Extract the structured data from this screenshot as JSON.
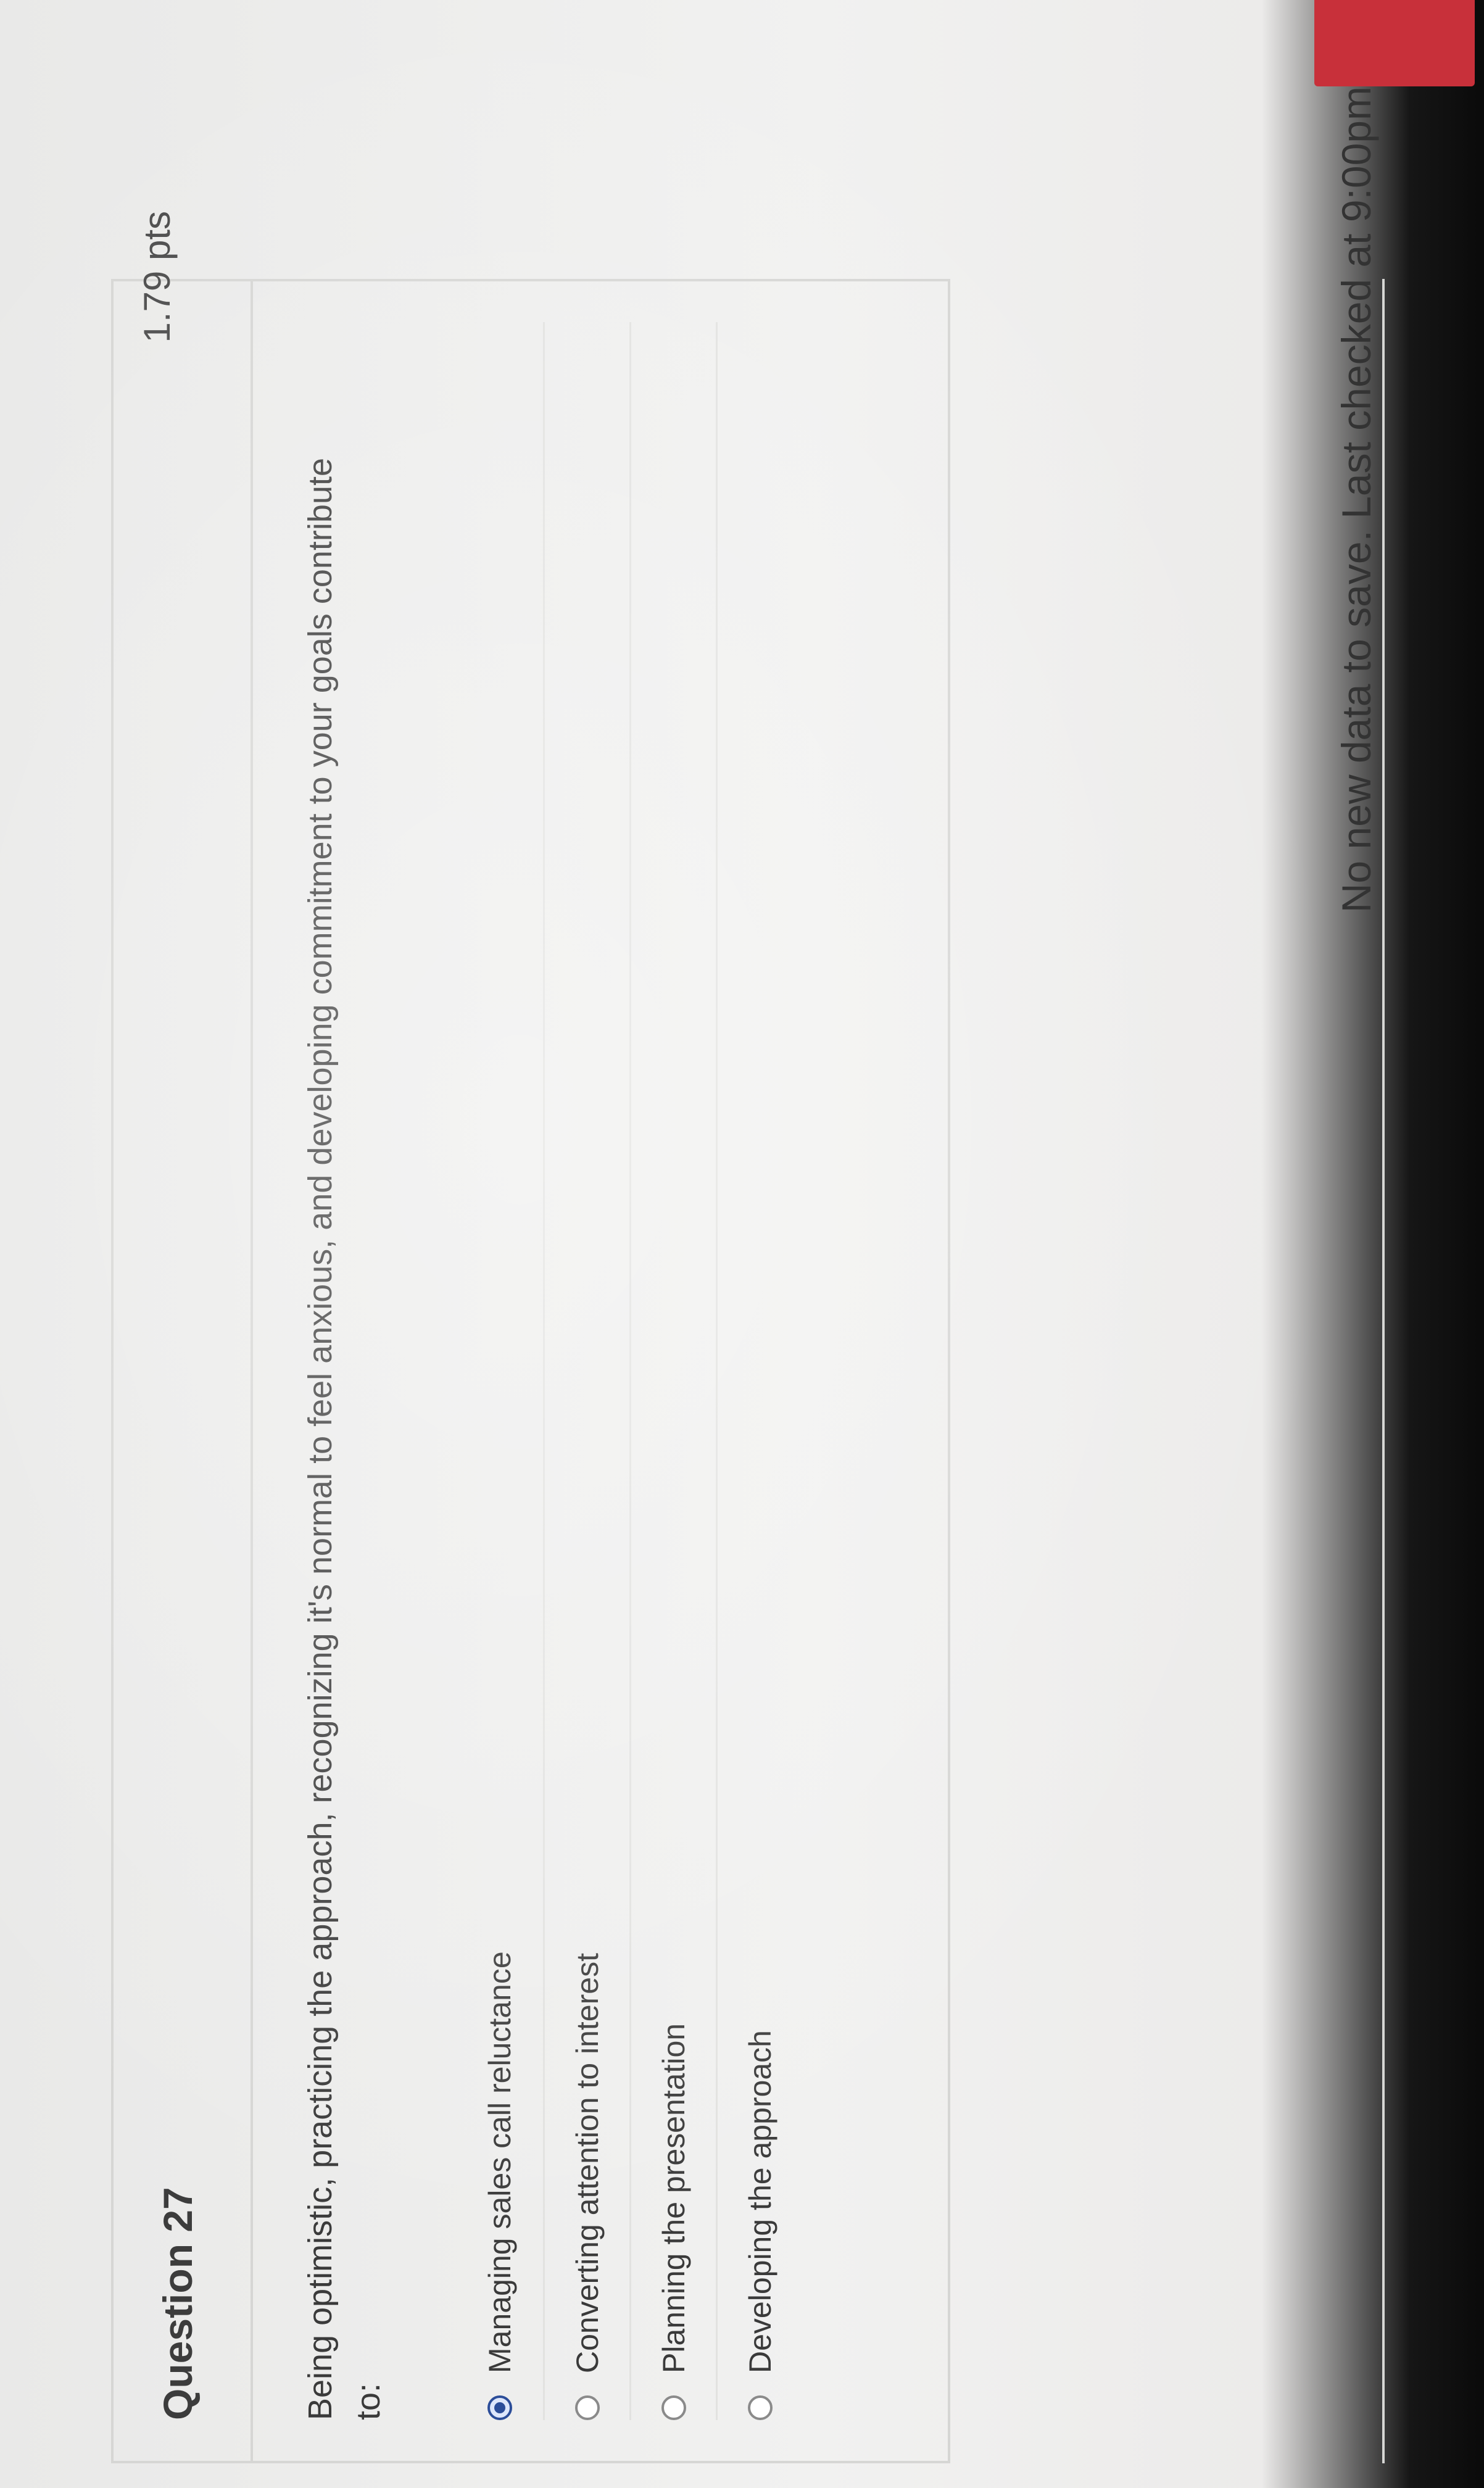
{
  "question": {
    "title": "Question 27",
    "points": "1.79 pts",
    "text": "Being optimistic, practicing the approach, recognizing it's normal to feel anxious, and developing commitment to your goals contribute to:"
  },
  "answers": [
    {
      "label": "Managing sales call reluctance",
      "selected": true
    },
    {
      "label": "Converting attention to interest",
      "selected": false
    },
    {
      "label": "Planning the presentation",
      "selected": false
    },
    {
      "label": "Developing the approach",
      "selected": false
    }
  ],
  "status": {
    "text": "No new data to save. Last checked at 9:00pm"
  },
  "colors": {
    "selected_radio": "#2b4d99",
    "submit_button": "#c8303a"
  }
}
